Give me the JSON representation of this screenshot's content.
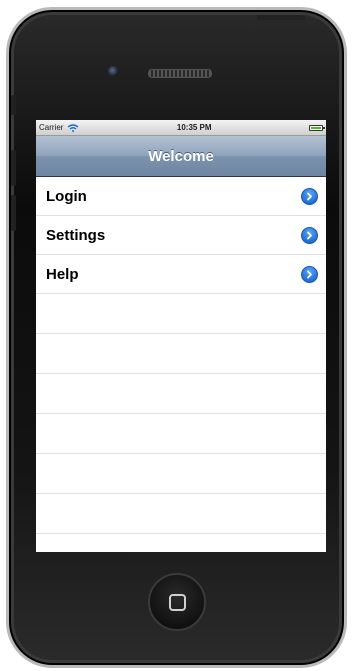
{
  "status_bar": {
    "carrier": "Carrier",
    "time": "10:35 PM",
    "wifi_icon": "wifi-icon",
    "battery_icon": "battery-icon",
    "battery_color": "#45c21a"
  },
  "nav": {
    "title": "Welcome"
  },
  "menu": {
    "items": [
      {
        "label": "Login",
        "accessory": "disclosure-arrow-icon"
      },
      {
        "label": "Settings",
        "accessory": "disclosure-arrow-icon"
      },
      {
        "label": "Help",
        "accessory": "disclosure-arrow-icon"
      }
    ]
  },
  "theme": {
    "nav_bar_color": "#8ea3bc",
    "disclosure_color": "#2470d6"
  }
}
